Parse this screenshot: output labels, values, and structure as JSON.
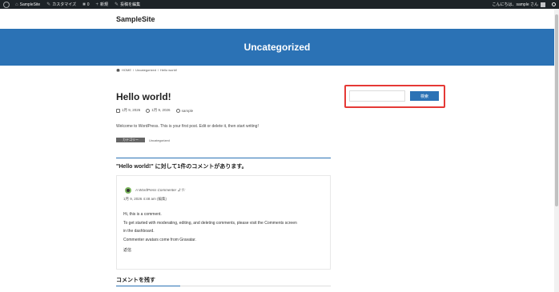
{
  "admin_bar": {
    "site_name": "SampleSite",
    "customize": "カスタマイズ",
    "comments_count": "0",
    "new": "新規",
    "edit_post": "投稿を編集",
    "greeting": "こんにちは、sample さん"
  },
  "header": {
    "site_title": "SampleSite"
  },
  "banner": {
    "title": "Uncategorized"
  },
  "breadcrumb": {
    "home": "HOME",
    "category": "Uncategorized",
    "current": "Hello world!",
    "separator": "/"
  },
  "post": {
    "title": "Hello world!",
    "published": "1月 9, 2026",
    "updated": "1月 9, 2026",
    "author": "sample",
    "body": "Welcome to WordPress. This is your first post. Edit or delete it, then start writing!",
    "category_label": "カテゴリー",
    "category_value": "Uncategorized"
  },
  "comments": {
    "heading": "\"Hello world!\" に対して1件のコメントがあります。",
    "items": [
      {
        "author": "A WordPress Commenter より:",
        "date": "1月 9, 2026 4:48 am (編集)",
        "lines": [
          "Hi, this is a comment.",
          "To get started with moderating, editing, and deleting comments, please visit the Comments screen",
          "in the dashboard.",
          "Commenter avatars come from Gravatar."
        ],
        "reply": "返信"
      }
    ],
    "leave_heading": "コメントを残す"
  },
  "sidebar": {
    "search": {
      "placeholder": "",
      "button": "検索"
    }
  },
  "colors": {
    "brand": "#2b72b5",
    "admin_bar": "#1d2327",
    "highlight": "#e53935"
  },
  "icons": [
    "wordpress-logo-icon",
    "site-icon",
    "brush-icon",
    "comment-icon",
    "plus-icon",
    "pencil-icon",
    "avatar-icon",
    "search-icon",
    "home-icon",
    "calendar-icon",
    "refresh-icon",
    "user-icon",
    "gravatar-icon"
  ]
}
